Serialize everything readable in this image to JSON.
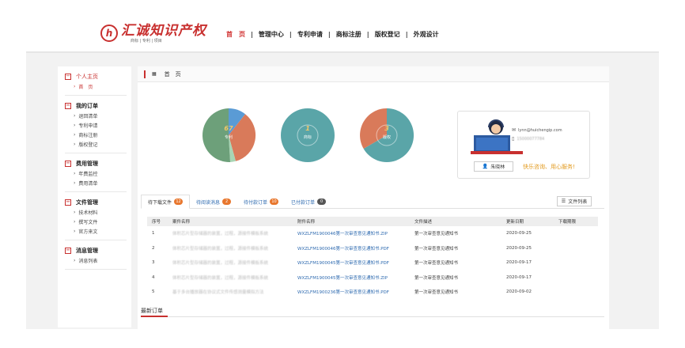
{
  "brand": {
    "mark": "h",
    "title": "汇诚知识产权",
    "subtitle": "商标 | 专利 | 项目"
  },
  "nav": {
    "items": [
      {
        "label": "首　页",
        "active": true
      },
      {
        "label": "管理中心",
        "active": false
      },
      {
        "label": "专利申请",
        "active": false
      },
      {
        "label": "商标注册",
        "active": false
      },
      {
        "label": "版权登记",
        "active": false
      },
      {
        "label": "外观设计",
        "active": false
      }
    ],
    "separator": "|"
  },
  "sidebar": {
    "groups": [
      {
        "title": "个人主页",
        "items": [
          "首　页"
        ]
      },
      {
        "title": "我的订单",
        "items": [
          "退回清单",
          "专利申请",
          "商标注册",
          "版权登记"
        ]
      },
      {
        "title": "费用管理",
        "items": [
          "年费监控",
          "费用清单"
        ]
      },
      {
        "title": "文件管理",
        "items": [
          "技术材料",
          "撰写文件",
          "官方来文"
        ]
      },
      {
        "title": "消息管理",
        "items": [
          "消息列表"
        ]
      }
    ]
  },
  "breadcrumb": {
    "icon": "home-icon",
    "label": "首　页"
  },
  "stats": [
    {
      "value": "67",
      "label": "专利",
      "colors": [
        "#5a9bd5",
        "#d97a5a",
        "#79b787",
        "#5e9e6e"
      ]
    },
    {
      "value": "1",
      "label": "商标",
      "colors": [
        "#5aa5a8"
      ]
    },
    {
      "value": "3",
      "label": "版权",
      "colors": [
        "#5aa5a8",
        "#d97a5a"
      ]
    }
  ],
  "contact": {
    "email": "lynn@huichengip.com",
    "phone": "15000077784",
    "name": "朱晓林",
    "slogan": "快乐咨询、用心服务!"
  },
  "tabs": [
    {
      "label": "待下载文件",
      "count": "12",
      "badge_color": "#e8772e",
      "active": true
    },
    {
      "label": "待阅读消息",
      "count": "2",
      "badge_color": "#e8772e",
      "active": false
    },
    {
      "label": "待付款订单",
      "count": "10",
      "badge_color": "#e8772e",
      "active": false
    },
    {
      "label": "已付款订单",
      "count": "0",
      "badge_color": "#555555",
      "active": false
    }
  ],
  "file_list_button": "文件列表",
  "table": {
    "headers": [
      "序号",
      "案件名称",
      "附件名称",
      "文件描述",
      "更新日期",
      "下载期限"
    ],
    "rows": [
      {
        "no": "1",
        "case": "体积芯片型存储器的装置，过程，源接件模板系统",
        "file": "WXZLFM1900046第一次审查意见通知书.ZIP",
        "desc": "第一次审查意见通知书",
        "date": "2020-09-25",
        "limit": ""
      },
      {
        "no": "2",
        "case": "体积芯片型存储器的装置，过程，源接件模板系统",
        "file": "WXZLFM1900046第一次审查意见通知书.PDF",
        "desc": "第一次审查意见通知书",
        "date": "2020-09-25",
        "limit": ""
      },
      {
        "no": "3",
        "case": "体积芯片型存储器的装置，过程，源接件模板系统",
        "file": "WXZLFM1900045第一次审查意见通知书.PDF",
        "desc": "第一次审查意见通知书",
        "date": "2020-09-17",
        "limit": ""
      },
      {
        "no": "4",
        "case": "体积芯片型存储器的装置，过程，源接件模板系统",
        "file": "WXZLFM1900045第一次审查意见通知书.ZIP",
        "desc": "第一次审查意见通知书",
        "date": "2020-09-17",
        "limit": ""
      },
      {
        "no": "5",
        "case": "基于多台播放器在协议式文件传感测量模拟方法",
        "file": "WXZLFM1900236第一次审查意见通知书.PDF",
        "desc": "第一次审查意见通知书",
        "date": "2020-09-02",
        "limit": ""
      }
    ]
  },
  "latest_orders": {
    "title": "最新订单"
  }
}
